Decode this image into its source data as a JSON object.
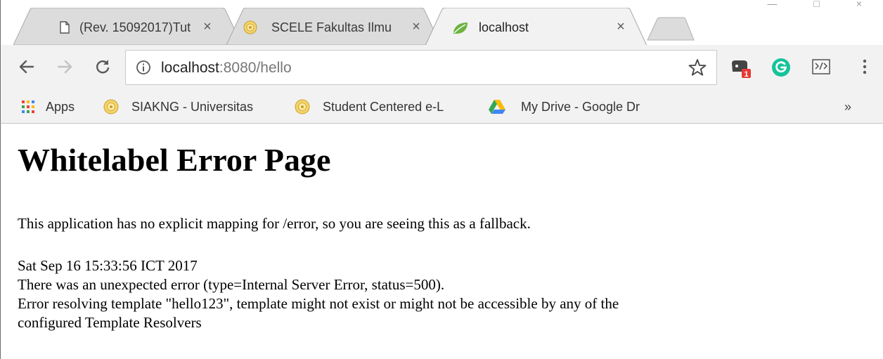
{
  "browser": {
    "tabs": [
      {
        "title": "(Rev. 15092017)Tut",
        "close": "×",
        "active": false,
        "icon": "document-icon"
      },
      {
        "title": "SCELE Fakultas Ilmu",
        "close": "×",
        "active": false,
        "icon": "university-seal-icon"
      },
      {
        "title": "localhost",
        "close": "×",
        "active": true,
        "icon": "spring-leaf-icon"
      }
    ],
    "address": {
      "host": "localhost",
      "rest": ":8080/hello"
    },
    "extension_badge": "1",
    "bookmarks": [
      {
        "label": "Apps",
        "icon": "apps-grid-icon"
      },
      {
        "label": "SIAKNG - Universitas",
        "icon": "university-seal-icon"
      },
      {
        "label": "Student Centered e-L",
        "icon": "university-seal-icon"
      },
      {
        "label": "My Drive - Google Dr",
        "icon": "google-drive-icon"
      }
    ],
    "overflow": "»",
    "colors": {
      "accent_green": "#6DB33F",
      "grammarly": "#15C39A",
      "badge": "#E53935"
    }
  },
  "page": {
    "heading": "Whitelabel Error Page",
    "message": "This application has no explicit mapping for /error, so you are seeing this as a fallback.",
    "timestamp": "Sat Sep 16 15:33:56 ICT 2017",
    "error_type": "There was an unexpected error (type=Internal Server Error, status=500).",
    "error_detail_line1": "Error resolving template \"hello123\", template might not exist or might not be accessible by any of the",
    "error_detail_line2": "configured Template Resolvers"
  }
}
